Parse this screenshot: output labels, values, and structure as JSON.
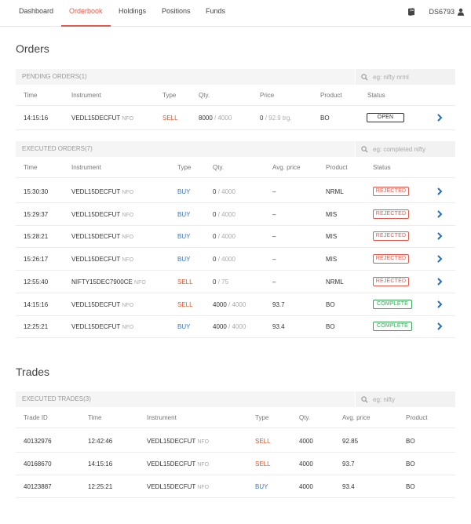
{
  "nav": {
    "items": [
      {
        "label": "Dashboard",
        "active": false
      },
      {
        "label": "Orderbook",
        "active": true
      },
      {
        "label": "Holdings",
        "active": false
      },
      {
        "label": "Positions",
        "active": false
      },
      {
        "label": "Funds",
        "active": false
      }
    ],
    "user_id": "DS6793",
    "accent_color": "#e15b4c"
  },
  "orders": {
    "title": "Orders",
    "pending": {
      "title": "PENDING ORDERS(1)",
      "search_placeholder": "eg: nifty nrml",
      "columns": [
        "Time",
        "Instrument",
        "Type",
        "Qty.",
        "Price",
        "Product",
        "Status"
      ],
      "rows": [
        {
          "time": "14:15:16",
          "instrument": "VEDL15DECFUT",
          "exchange": "NFO",
          "type": "SELL",
          "qty_filled": "8000",
          "qty_total": "/ 4000",
          "price": "0",
          "price_extra": "/ 92.9 trg.",
          "product": "BO",
          "status": "OPEN"
        }
      ]
    },
    "executed": {
      "title": "EXECUTED ORDERS(7)",
      "search_placeholder": "eg: completed nifty",
      "columns": [
        "Time",
        "Instrument",
        "Type",
        "Qty.",
        "Avg. price",
        "Product",
        "Status"
      ],
      "rows": [
        {
          "time": "15:30:30",
          "instrument": "VEDL15DECFUT",
          "exchange": "NFO",
          "type": "BUY",
          "qty_filled": "0",
          "qty_total": "/ 4000",
          "avg_price": "–",
          "product": "NRML",
          "status": "REJECTED"
        },
        {
          "time": "15:29:37",
          "instrument": "VEDL15DECFUT",
          "exchange": "NFO",
          "type": "BUY",
          "qty_filled": "0",
          "qty_total": "/ 4000",
          "avg_price": "–",
          "product": "MIS",
          "status": "REJECTED"
        },
        {
          "time": "15:28:21",
          "instrument": "VEDL15DECFUT",
          "exchange": "NFO",
          "type": "BUY",
          "qty_filled": "0",
          "qty_total": "/ 4000",
          "avg_price": "–",
          "product": "MIS",
          "status": "REJECTED"
        },
        {
          "time": "15:26:17",
          "instrument": "VEDL15DECFUT",
          "exchange": "NFO",
          "type": "BUY",
          "qty_filled": "0",
          "qty_total": "/ 4000",
          "avg_price": "–",
          "product": "MIS",
          "status": "REJECTED"
        },
        {
          "time": "12:55:40",
          "instrument": "NIFTY15DEC7900CE",
          "exchange": "NFO",
          "type": "SELL",
          "qty_filled": "0",
          "qty_total": "/ 75",
          "avg_price": "–",
          "product": "NRML",
          "status": "REJECTED"
        },
        {
          "time": "14:15:16",
          "instrument": "VEDL15DECFUT",
          "exchange": "NFO",
          "type": "SELL",
          "qty_filled": "4000",
          "qty_total": "/ 4000",
          "avg_price": "93.7",
          "product": "BO",
          "status": "COMPLETE"
        },
        {
          "time": "12:25:21",
          "instrument": "VEDL15DECFUT",
          "exchange": "NFO",
          "type": "BUY",
          "qty_filled": "4000",
          "qty_total": "/ 4000",
          "avg_price": "93.4",
          "product": "BO",
          "status": "COMPLETE"
        }
      ]
    }
  },
  "trades": {
    "title": "Trades",
    "executed": {
      "title": "EXECUTED TRADES(3)",
      "search_placeholder": "eg: nifty",
      "columns": [
        "Trade ID",
        "Time",
        "Instrument",
        "Type",
        "Qty.",
        "Avg. price",
        "Product"
      ],
      "rows": [
        {
          "trade_id": "40132976",
          "time": "12:42:46",
          "instrument": "VEDL15DECFUT",
          "exchange": "NFO",
          "type": "SELL",
          "qty": "4000",
          "avg_price": "92.85",
          "product": "BO"
        },
        {
          "trade_id": "40168670",
          "time": "14:15:16",
          "instrument": "VEDL15DECFUT",
          "exchange": "NFO",
          "type": "SELL",
          "qty": "4000",
          "avg_price": "93.7",
          "product": "BO"
        },
        {
          "trade_id": "40123887",
          "time": "12:25:21",
          "instrument": "VEDL15DECFUT",
          "exchange": "NFO",
          "type": "BUY",
          "qty": "4000",
          "avg_price": "93.4",
          "product": "BO"
        }
      ]
    }
  },
  "colors": {
    "sell": "#e0572e",
    "buy": "#3878c0",
    "rejected": "#e15b4c",
    "complete": "#3aa35a"
  },
  "icons": {
    "book": "book-icon",
    "user": "user-icon",
    "search": "search-icon",
    "chevron": "chevron-right-icon"
  }
}
